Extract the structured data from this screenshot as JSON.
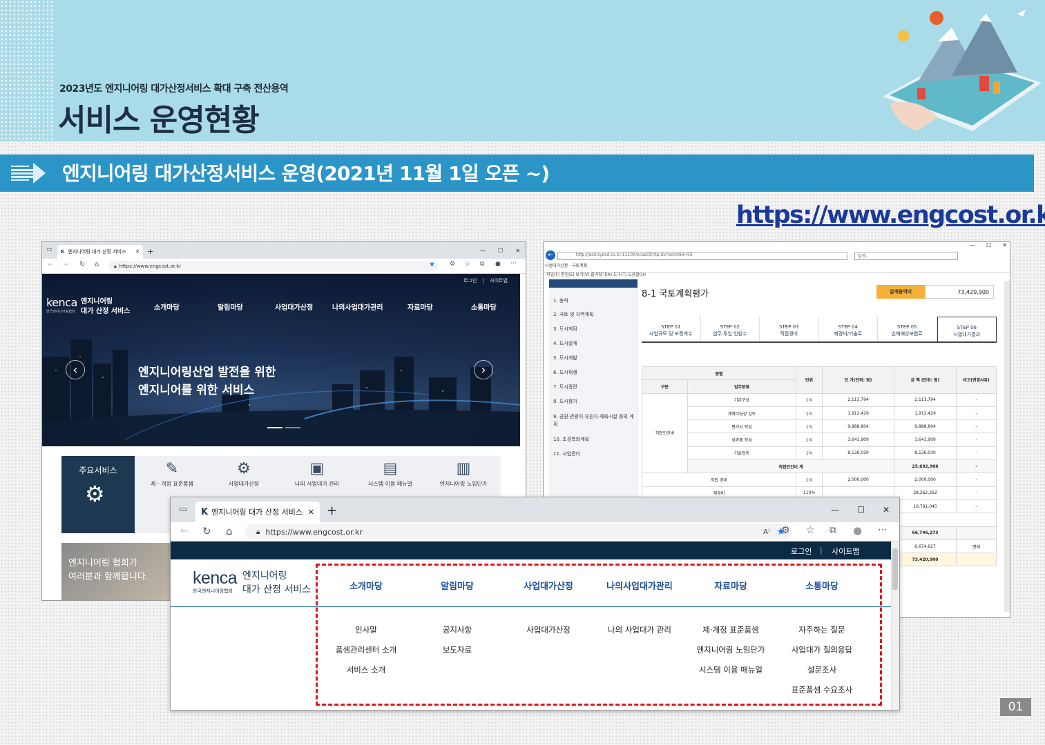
{
  "banner": {
    "subtitle": "2023년도 엔지니어링 대가산정서비스 확대 구축 전산용역",
    "title": "서비스 운영현황"
  },
  "section": {
    "title": "엔지니어링 대가산정서비스 운영(2021년 11월 1일 오픈 ~)"
  },
  "site_url": "https://www.engcost.or.kr",
  "win1": {
    "tab_title": "엔지니어링 대가 산정 서비스",
    "url": "https://www.engcost.or.kr",
    "util_login": "로그인",
    "util_sitemap": "사이트맵",
    "logo_word": "kenca",
    "logo_sub": "한국엔지니어링협회",
    "brand_line1": "엔지니어링",
    "brand_line2": "대가 산정 서비스",
    "nav": [
      "소개마당",
      "알림마당",
      "사업대가산정",
      "나의사업대가관리",
      "자료마당",
      "소통마당"
    ],
    "hero_line1": "엔지니어링산업 발전을 위한",
    "hero_line2": "엔지니어를 위한 서비스",
    "services_label": "주요서비스",
    "services": [
      "제 · 개정 표준품셈",
      "사업대가산정",
      "나의 사업대가 관리",
      "시스템 이용 매뉴얼",
      "엔지니어링 노임단가"
    ],
    "promo_line1": "엔지니어링 협회가",
    "promo_line2": "여러분과 함께합니다."
  },
  "win2": {
    "url": "http://esd.syesd.co.kr:11100/ecasCtrl/tp.do?estmtId=56",
    "search_placeholder": "검색...",
    "tab_title": "사업대가산정 - 국토계획",
    "menu": "파일(F)   편집(E)   보기(V)   즐겨찾기(A)   도구(T)   도움말(H)",
    "side_items": [
      "1. 총칙",
      "2. 국토 및 지역계획",
      "3. 도시계획",
      "4. 도시설계",
      "5. 도시개발",
      "6. 도시재생",
      "7. 도시경관",
      "8. 도시평가",
      "9. 공원·관광지·유원지·체육시설 등의 계획",
      "10. 조경특화계획",
      "11. 사업관리"
    ],
    "page_title": "8-1 국토계획평가",
    "amount_label": "설계용역비",
    "amount_value": "73,420,900",
    "steps": [
      {
        "no": "STEP 01",
        "label": "사업규모 및 보정계수"
      },
      {
        "no": "STEP 02",
        "label": "업무·투입 인원수"
      },
      {
        "no": "STEP 03",
        "label": "직접경비"
      },
      {
        "no": "STEP 04",
        "label": "제경비/기술료"
      },
      {
        "no": "STEP 05",
        "label": "손해배상보험료"
      },
      {
        "no": "STEP 06",
        "label": "사업대가결과"
      }
    ],
    "table_head": {
      "group": "종별",
      "kind": "구분",
      "task": "업무분류",
      "unit": "단위",
      "price": "단 가(단위: 원)",
      "amount": "금 액 (단위: 원)",
      "note": "비고(변경사유)"
    },
    "group_label": "직접인건비",
    "rows": [
      {
        "task": "기본구상",
        "unit": "1식",
        "price": "2,113,794",
        "amount": "2,113,794",
        "note": "-"
      },
      {
        "task": "계획타당성 검토",
        "unit": "1식",
        "price": "1,912,429",
        "amount": "1,912,429",
        "note": "-"
      },
      {
        "task": "평가서 작성",
        "unit": "1식",
        "price": "9,888,804",
        "amount": "9,888,804",
        "note": "-"
      },
      {
        "task": "성과품 작성",
        "unit": "1식",
        "price": "3,641,909",
        "amount": "3,641,909",
        "note": "-"
      },
      {
        "task": "기술협의",
        "unit": "1식",
        "price": "8,136,030",
        "amount": "8,136,030",
        "note": "-"
      }
    ],
    "subtotal": {
      "label": "직접인건비 계",
      "amount": "25,692,966",
      "note": "-"
    },
    "direct_expense": {
      "label": "직접 경비",
      "unit": "1식",
      "price": "2,000,000",
      "amount": "2,000,000",
      "note": "-"
    },
    "overhead": {
      "label": "제경비",
      "unit": "110%",
      "amount": "28,262,262",
      "note": "-"
    },
    "extra_amounts": [
      "10,791,045",
      "66,746,273",
      "6,674,627",
      "73,420,900"
    ],
    "extra_note": "면제"
  },
  "win3": {
    "tab_title": "엔지니어링 대가 산정 서비스",
    "url": "https://www.engcost.or.kr",
    "util_login": "로그인",
    "util_sep": "|",
    "util_sitemap": "사이트맵",
    "logo_word": "kenca",
    "logo_sub": "한국엔지니어링협회",
    "brand_line1": "엔지니어링",
    "brand_line2": "대가 산정 서비스",
    "nav": [
      "소개마당",
      "알림마당",
      "사업대가산정",
      "나의사업대가관리",
      "자료마당",
      "소통마당"
    ],
    "sub": [
      [
        "인사말",
        "품셈관리센터 소개",
        "서비스 소개"
      ],
      [
        "공지사항",
        "보도자료"
      ],
      [
        "사업대가산정"
      ],
      [
        "나의 사업대가 관리"
      ],
      [
        "제·개정 표준품셈",
        "엔지니어링 노임단가",
        "시스템 이용 매뉴얼"
      ],
      [
        "자주하는 질문",
        "사업대가 질의응답",
        "설문조사",
        "표준품셈 수요조사"
      ]
    ]
  },
  "page_number": "01",
  "colors": {
    "banner_bg": "#a9dbe8",
    "section_bar": "#2c95c8",
    "nav_blue": "#1d4f9a",
    "highlight_dash": "#e0141a",
    "amount_badge": "#f4b13c"
  }
}
